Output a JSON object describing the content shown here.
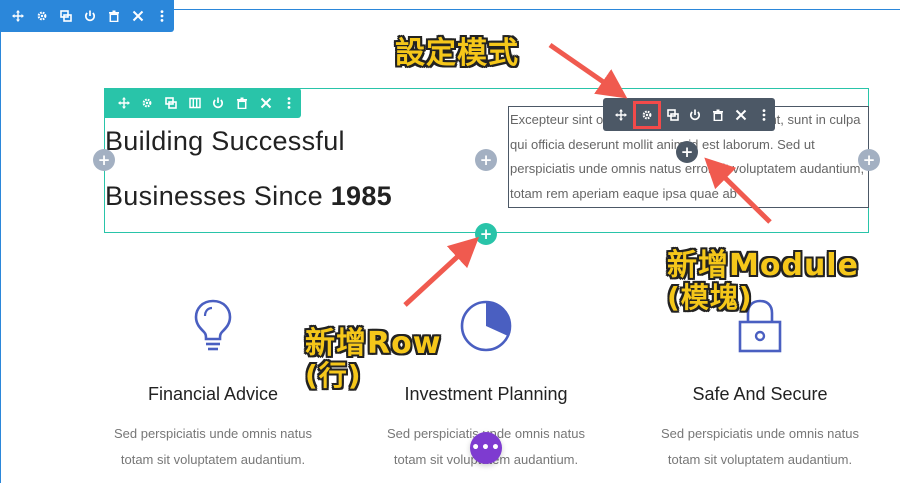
{
  "section_toolbar": {
    "icons": [
      "move-icon",
      "gear-icon",
      "duplicate-icon",
      "power-icon",
      "trash-icon",
      "close-icon",
      "more-icon"
    ]
  },
  "row_toolbar": {
    "icons": [
      "move-icon",
      "gear-icon",
      "duplicate-icon",
      "columns-icon",
      "power-icon",
      "trash-icon",
      "close-icon",
      "more-icon"
    ]
  },
  "module_toolbar": {
    "icons": [
      "move-icon",
      "gear-icon",
      "duplicate-icon",
      "power-icon",
      "trash-icon",
      "close-icon",
      "more-icon"
    ],
    "active": "gear-icon"
  },
  "heading": {
    "line1": "Building Successful",
    "line2_text": "Businesses Since ",
    "line2_bold": "1985"
  },
  "module_text": "Excepteur sint occaecat cupidatat non proident, sunt in culpa qui officia deserunt mollit anim id est laborum. Sed ut perspiciatis unde omnis natus error sit voluptatem audantium, totam rem aperiam eaque ipsa quae ab",
  "blurbs": [
    {
      "title": "Financial Advice",
      "body_line1": "Sed perspiciatis unde omnis natus",
      "body_line2": "totam sit voluptatem audantium.",
      "icon": "lightbulb-icon"
    },
    {
      "title": "Investment Planning",
      "body_line1": "Sed perspiciatis unde omnis natus",
      "body_line2": "totam sit voluptatem audantium.",
      "icon": "pie-chart-icon"
    },
    {
      "title": "Safe And Secure",
      "body_line1": "Sed perspiciatis unde omnis natus",
      "body_line2": "totam sit voluptatem audantium.",
      "icon": "lock-icon"
    }
  ],
  "annotations": {
    "settings_mode": "設定模式",
    "add_module_line1": "新增Module",
    "add_module_line2": "(模塊)",
    "add_row_line1": "新增Row",
    "add_row_line2": "(行)"
  },
  "buttons": {
    "plus": "+",
    "fab": "•••"
  },
  "colors": {
    "section": "#2b87da",
    "row": "#29c4a9",
    "module": "#4c5866",
    "highlight": "#f24a4a",
    "annotation": "#f5c71a",
    "arrow": "#f05a4f",
    "fab": "#7e3bd0",
    "icon_blue": "#4a5fc1"
  }
}
